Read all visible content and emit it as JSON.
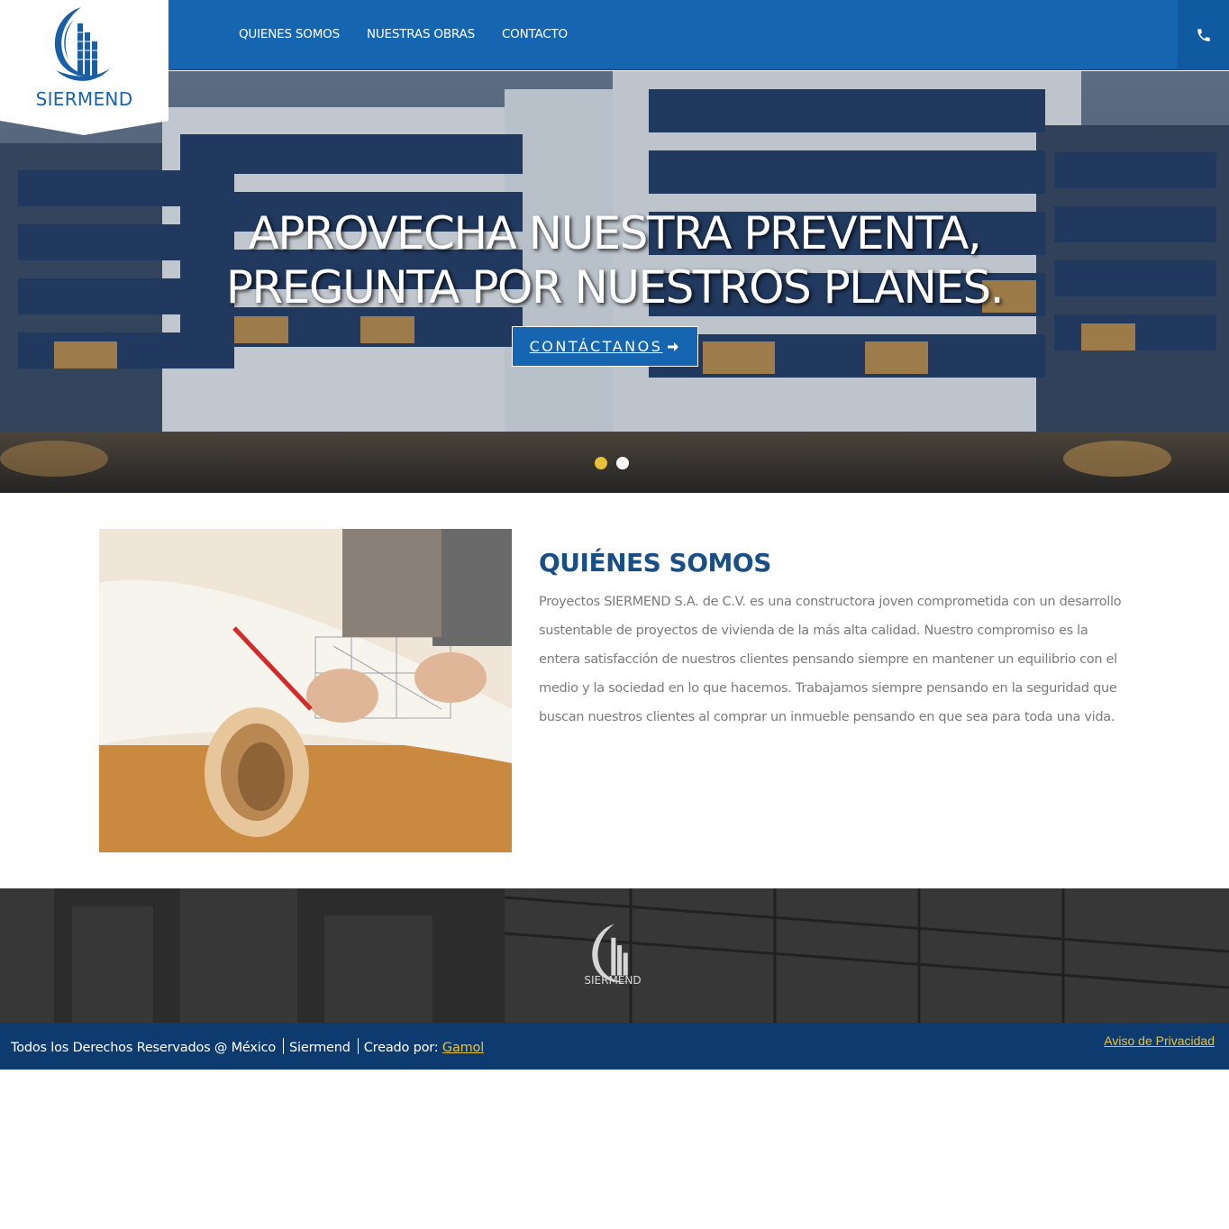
{
  "brand": {
    "name": "SIERMEND"
  },
  "nav": {
    "items": [
      {
        "label": "QUIENES SOMOS"
      },
      {
        "label": "NUESTRAS OBRAS"
      },
      {
        "label": "CONTACTO"
      }
    ],
    "phone_icon": "phone-icon"
  },
  "hero": {
    "title_line1": "APROVECHA NUESTRA PREVENTA,",
    "title_line2": "PREGUNTA POR NUESTROS PLANES.",
    "cta_label": "CONTÁCTANOS",
    "cta_icon": "arrow-right-icon",
    "slides": [
      {
        "active": true
      },
      {
        "active": false
      }
    ]
  },
  "about": {
    "title": "QUIÉNES SOMOS",
    "body": "Proyectos SIERMEND S.A. de C.V. es una constructora joven comprometida con un desarrollo sustentable de proyectos de vivienda de la más alta calidad. Nuestro compromiso es la entera satisfacción de nuestros clientes pensando siempre en mantener un equilibrio con el medio y la sociedad en lo que hacemos. Trabajamos siempre pensando en la seguridad que buscan nuestros clientes al comprar un inmueble pensando en que sea para toda una vida."
  },
  "footer": {
    "logo_text": "SIERMEND",
    "copyright": "Todos los Derechos Reservados @ México",
    "company": "Siermend",
    "created_by_label": "Creado por:",
    "created_by_link": "Gamol",
    "privacy_link": "Aviso de Privacidad"
  },
  "colors": {
    "primary": "#1565b0",
    "footer_bar": "#0d3b70",
    "accent_gold": "#e8c13a",
    "title_blue": "#1a4f86"
  }
}
